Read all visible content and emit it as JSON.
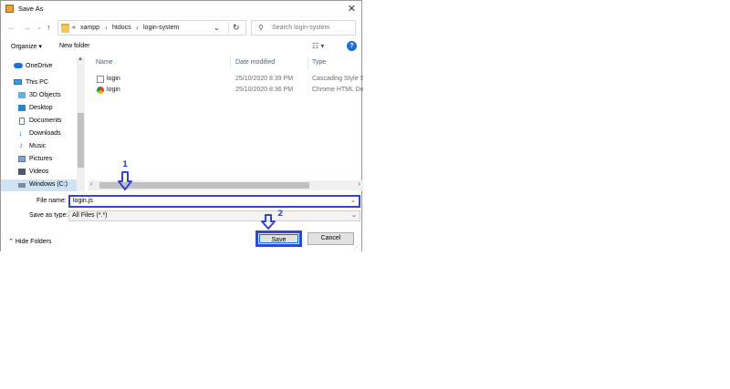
{
  "window": {
    "title": "Save As",
    "close_symbol": "✕"
  },
  "address_bar": {
    "overflow": "«",
    "crumbs": [
      "xampp",
      "htdocs",
      "login-system"
    ],
    "dropdown": "⌄",
    "refresh": "↻"
  },
  "search": {
    "placeholder": "Search login-system"
  },
  "toolbar": {
    "organize": "Organize ▾",
    "new_folder": "New folder",
    "view": "☷ ▾",
    "help": "?"
  },
  "nav_pane": {
    "items": [
      {
        "label": "OneDrive",
        "icon": "onedrive-icon"
      },
      {
        "label": "This PC",
        "icon": "computer-icon"
      },
      {
        "label": "3D Objects",
        "icon": "3d-objects-icon"
      },
      {
        "label": "Desktop",
        "icon": "desktop-icon"
      },
      {
        "label": "Documents",
        "icon": "documents-icon"
      },
      {
        "label": "Downloads",
        "icon": "downloads-icon"
      },
      {
        "label": "Music",
        "icon": "music-icon"
      },
      {
        "label": "Pictures",
        "icon": "pictures-icon"
      },
      {
        "label": "Videos",
        "icon": "videos-icon"
      },
      {
        "label": "Windows (C:)",
        "icon": "drive-icon",
        "selected": true
      }
    ]
  },
  "file_list": {
    "columns": [
      "Name",
      "Date modified",
      "Type"
    ],
    "rows": [
      {
        "name": "login",
        "date": "25/10/2020 8:39 PM",
        "type": "Cascading Style S...",
        "icon": "css-file-icon"
      },
      {
        "name": "login",
        "date": "25/10/2020 8:36 PM",
        "type": "Chrome HTML Do...",
        "icon": "chrome-html-icon"
      }
    ]
  },
  "form": {
    "file_name_label": "File name:",
    "file_name_value": "login.js",
    "save_as_type_label": "Save as type:",
    "save_as_type_value": "All Files (*.*)"
  },
  "footer": {
    "hide_folders": "Hide Folders",
    "save": "Save",
    "cancel": "Cancel"
  },
  "annotations": {
    "step1": "1",
    "step2": "2",
    "color": "#3546c8"
  }
}
